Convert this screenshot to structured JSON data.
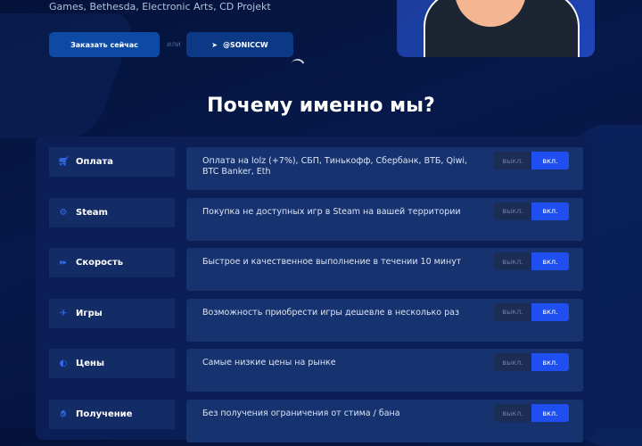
{
  "hero": {
    "subtitle": "Games, Bethesda, Electronic Arts, CD Projekt",
    "order_label": "Заказать сейчас",
    "or_label": "или",
    "telegram_label": "@SONICCW"
  },
  "section_title": "Почему именно мы?",
  "toggle": {
    "off": "выкл.",
    "on": "вкл."
  },
  "features": [
    {
      "icon": "cart-icon",
      "label": "Оплата",
      "text": "Оплата на lolz (+7%), СБП, Тинькофф, Сбербанк, ВТБ, Qiwi, BTC Banker, Eth",
      "state": "on"
    },
    {
      "icon": "steam-icon",
      "label": "Steam",
      "text": "Покупка не доступных игр в Steam на вашей территории",
      "state": "on"
    },
    {
      "icon": "fast-forward-icon",
      "label": "Скорость",
      "text": "Быстрое и качественное выполнение в течении 10 минут",
      "state": "on"
    },
    {
      "icon": "rocket-icon",
      "label": "Игры",
      "text": "Возможность приобрести игры дешевле в несколько раз",
      "state": "on"
    },
    {
      "icon": "coin-icon",
      "label": "Цены",
      "text": "Самые низкие цены на рынке",
      "state": "on"
    },
    {
      "icon": "hand-icon",
      "label": "Получение",
      "text": "Без получения ограничения от стима / бана",
      "state": "on"
    }
  ]
}
